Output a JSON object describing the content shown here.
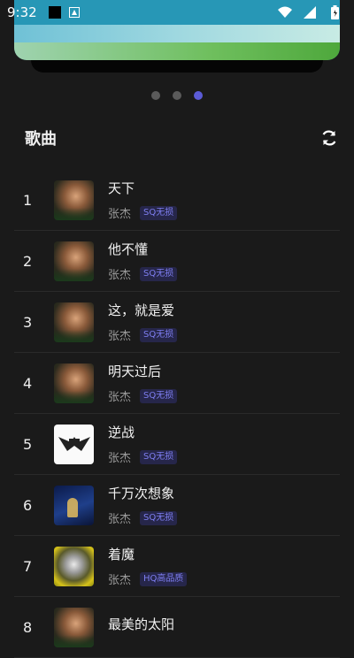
{
  "status_bar": {
    "time": "9:32"
  },
  "carousel": {
    "page_count": 3,
    "active_index": 2
  },
  "section": {
    "title": "歌曲"
  },
  "songs": [
    {
      "index": "1",
      "title": "天下",
      "artist": "张杰",
      "quality": "SQ无损",
      "cover_style": "face"
    },
    {
      "index": "2",
      "title": "他不懂",
      "artist": "张杰",
      "quality": "SQ无损",
      "cover_style": "face"
    },
    {
      "index": "3",
      "title": "这，就是爱",
      "artist": "张杰",
      "quality": "SQ无损",
      "cover_style": "face"
    },
    {
      "index": "4",
      "title": "明天过后",
      "artist": "张杰",
      "quality": "SQ无损",
      "cover_style": "face"
    },
    {
      "index": "5",
      "title": "逆战",
      "artist": "张杰",
      "quality": "SQ无损",
      "cover_style": "logo"
    },
    {
      "index": "6",
      "title": "千万次想象",
      "artist": "张杰",
      "quality": "SQ无损",
      "cover_style": "night"
    },
    {
      "index": "7",
      "title": "着魔",
      "artist": "张杰",
      "quality": "HQ高品质",
      "cover_style": "yellow"
    },
    {
      "index": "8",
      "title": "最美的太阳",
      "artist": "",
      "quality": "",
      "cover_style": "face"
    }
  ],
  "colors": {
    "accent": "#5b5bd6",
    "background": "#1a1a1a",
    "tag_text": "#7e7ef0",
    "tag_bg": "#26264a"
  }
}
